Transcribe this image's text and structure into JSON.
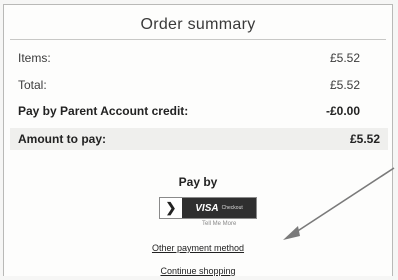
{
  "order_summary": {
    "title": "Order summary",
    "rows": [
      {
        "label": "Items:",
        "value": "£5.52"
      },
      {
        "label": "Total:",
        "value": "£5.52"
      },
      {
        "label": "Pay by Parent Account credit:",
        "value": "-£0.00"
      },
      {
        "label": "Amount to pay:",
        "value": "£5.52"
      }
    ]
  },
  "payment": {
    "heading": "Pay by",
    "visa_button": {
      "brand": "VISA",
      "suffix": "Checkout",
      "icon": "chevron-right-icon"
    },
    "tell_me_more": "Tell Me More",
    "other_method_link": "Other payment method",
    "continue_link": "Continue shopping"
  },
  "annotation": {
    "icon": "arrow-annotation",
    "color": "#7a7a7a"
  }
}
